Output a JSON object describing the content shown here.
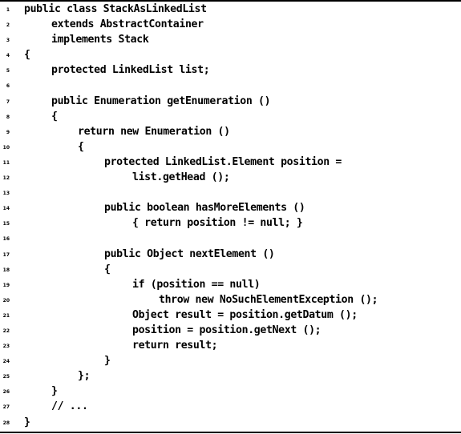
{
  "listing": {
    "lines": [
      {
        "num": "1",
        "indent": 0,
        "text": "public class StackAsLinkedList"
      },
      {
        "num": "2",
        "indent": 1,
        "text": "extends AbstractContainer"
      },
      {
        "num": "3",
        "indent": 1,
        "text": "implements Stack"
      },
      {
        "num": "4",
        "indent": 0,
        "text": "{"
      },
      {
        "num": "5",
        "indent": 1,
        "text": "protected LinkedList list;"
      },
      {
        "num": "6",
        "indent": 0,
        "text": ""
      },
      {
        "num": "7",
        "indent": 1,
        "text": "public Enumeration getEnumeration ()"
      },
      {
        "num": "8",
        "indent": 1,
        "text": "{"
      },
      {
        "num": "9",
        "indent": 2,
        "text": "return new Enumeration ()"
      },
      {
        "num": "10",
        "indent": 2,
        "text": "{"
      },
      {
        "num": "11",
        "indent": 3,
        "text": "protected LinkedList.Element position ="
      },
      {
        "num": "12",
        "indent": 4,
        "text": "list.getHead ();"
      },
      {
        "num": "13",
        "indent": 0,
        "text": ""
      },
      {
        "num": "14",
        "indent": 3,
        "text": "public boolean hasMoreElements ()"
      },
      {
        "num": "15",
        "indent": 4,
        "text": "{ return position != null; }"
      },
      {
        "num": "16",
        "indent": 0,
        "text": ""
      },
      {
        "num": "17",
        "indent": 3,
        "text": "public Object nextElement ()"
      },
      {
        "num": "18",
        "indent": 3,
        "text": "{"
      },
      {
        "num": "19",
        "indent": 4,
        "text": "if (position == null)"
      },
      {
        "num": "20",
        "indent": 5,
        "text": "throw new NoSuchElementException ();"
      },
      {
        "num": "21",
        "indent": 4,
        "text": "Object result = position.getDatum ();"
      },
      {
        "num": "22",
        "indent": 4,
        "text": "position = position.getNext ();"
      },
      {
        "num": "23",
        "indent": 4,
        "text": "return result;"
      },
      {
        "num": "24",
        "indent": 3,
        "text": "}"
      },
      {
        "num": "25",
        "indent": 2,
        "text": "};"
      },
      {
        "num": "26",
        "indent": 1,
        "text": "}"
      },
      {
        "num": "27",
        "indent": 1,
        "text": "// ..."
      },
      {
        "num": "28",
        "indent": 0,
        "text": "}"
      }
    ]
  }
}
